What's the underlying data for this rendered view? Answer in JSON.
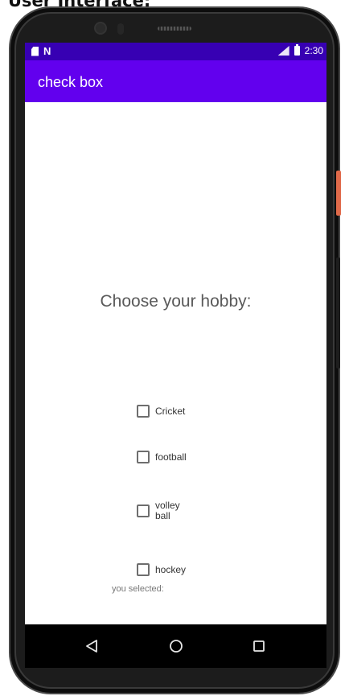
{
  "caption": "User Interface:",
  "status_bar": {
    "time": "2:30",
    "notification_icon": "n-icon",
    "sim_icon": "sim-icon",
    "signal_icon": "signal-icon",
    "battery_icon": "battery-icon"
  },
  "app_bar": {
    "title": "check box",
    "color": "#6200ee",
    "status_color": "#3700b3"
  },
  "main": {
    "heading": "Choose your hobby:",
    "checkboxes": [
      {
        "label": "Cricket",
        "checked": false
      },
      {
        "label": "football",
        "checked": false
      },
      {
        "label": "volley ball",
        "checked": false
      },
      {
        "label": "hockey",
        "checked": false
      }
    ],
    "selected_text": "you selected:"
  },
  "nav_bar": {
    "back_icon": "back-triangle-icon",
    "home_icon": "home-circle-icon",
    "recent_icon": "recent-square-icon"
  }
}
